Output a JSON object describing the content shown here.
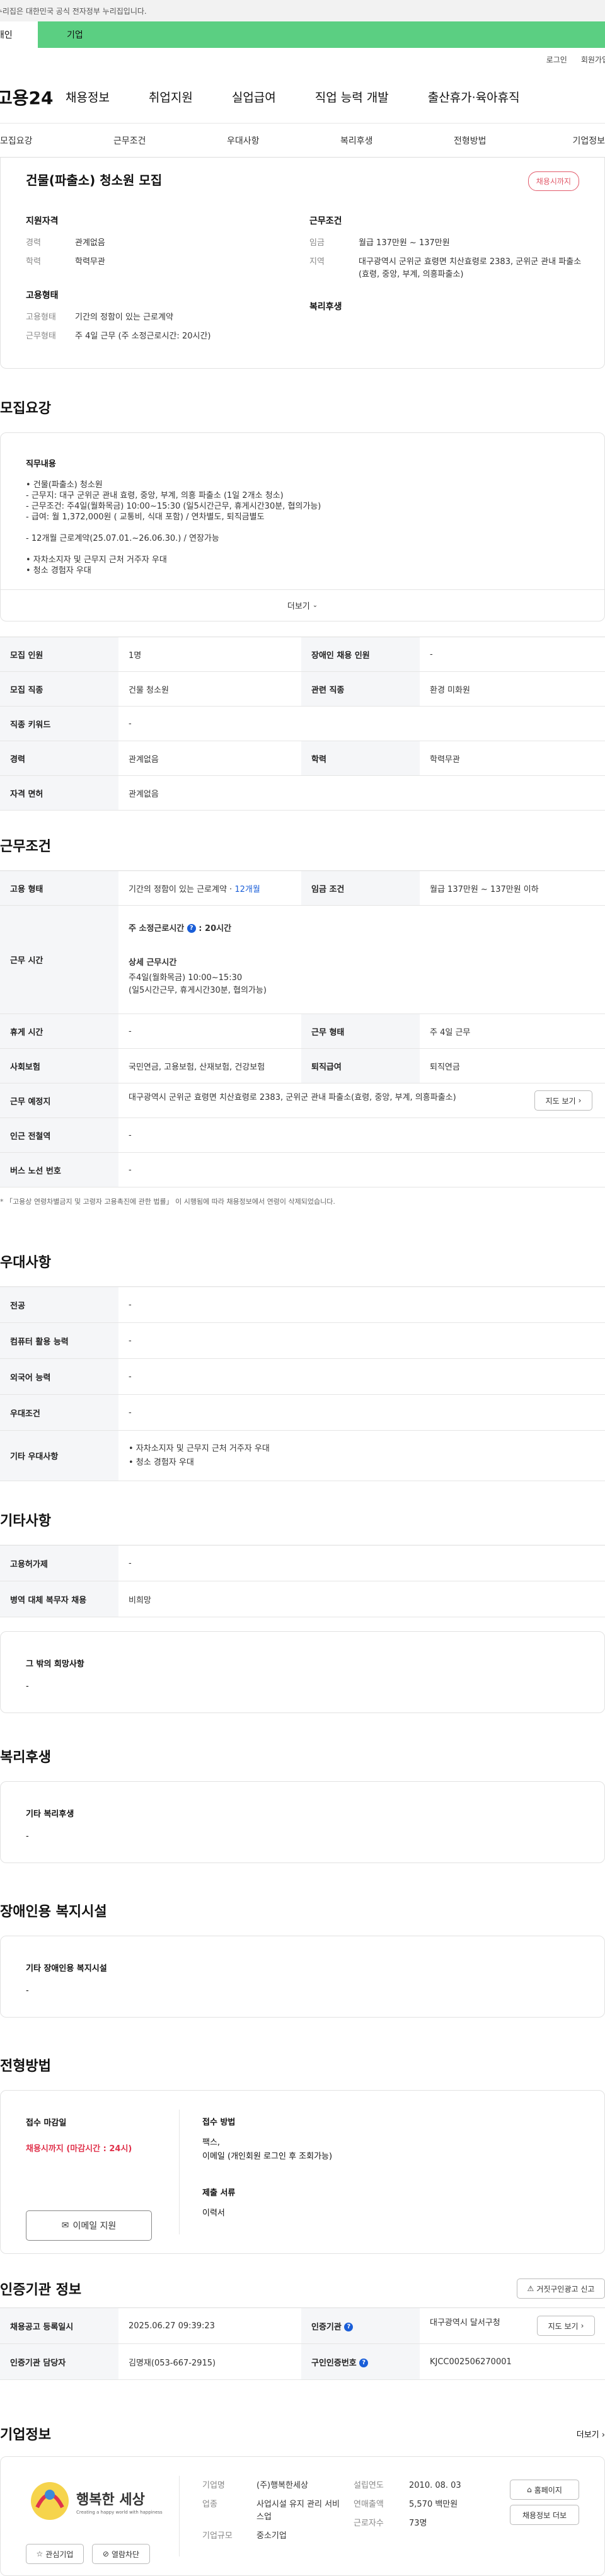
{
  "notice": "이 누리집은 대한민국 공식 전자정부 누리집입니다.",
  "site_tabs": [
    "개인",
    "기업"
  ],
  "util": [
    "로그인",
    "회원가입"
  ],
  "logo": "고용24",
  "gnb": [
    "채용정보",
    "취업지원",
    "실업급여",
    "직업 능력 개발",
    "출산휴가·육아휴직"
  ],
  "anchors": [
    "모집요강",
    "근무조건",
    "우대사항",
    "복리후생",
    "전형방법",
    "기업정보"
  ],
  "header": {
    "title": "건물(파출소) 청소원 모집",
    "badge": "채용시까지"
  },
  "summary": {
    "qual_title": "지원자격",
    "qual": [
      {
        "k": "경력",
        "v": "관계없음"
      },
      {
        "k": "학력",
        "v": "학력무관"
      }
    ],
    "cond_title": "근무조건",
    "cond": [
      {
        "k": "임금",
        "v": "월급 137만원 ~ 137만원"
      },
      {
        "k": "지역",
        "v": "대구광역시 군위군 효령면 치산효령로 2383, 군위군 관내 파출소(효령, 중앙, 부계, 의흥파출소)"
      }
    ],
    "emp_title": "고용형태",
    "emp": [
      {
        "k": "고용형태",
        "v": "기간의 정함이 있는 근로계약"
      },
      {
        "k": "근무형태",
        "v": "주 4일 근무 (주 소정근로시간: 20시간)"
      }
    ],
    "welfare_title": "복리후생"
  },
  "recruit": {
    "title": "모집요강",
    "duty_title": "직무내용",
    "duty_lines": [
      "• 건물(파출소) 청소원",
      "- 근무지: 대구 군위군 관내 효령, 중앙, 부계, 의흥 파출소 (1일 2개소 청소)",
      "- 근무조건: 주4일(월화목금) 10:00~15:30 (일5시간근무, 휴게시간30분, 협의가능)",
      "- 급여: 월 1,372,000원 ( 교통비, 식대 포함) / 연차별도, 퇴직금별도",
      "",
      "- 12개월 근로계약(25.07.01.~26.06.30.) / 연장가능",
      "",
      "• 자차소지자 및 근무지 근처 거주자 우대",
      "• 청소 경험자 우대"
    ],
    "more": "더보기",
    "rows": [
      {
        "h1": "모집 인원",
        "v1": "1명",
        "h2": "장애인 채용 인원",
        "v2": "-"
      },
      {
        "h1": "모집 직종",
        "v1": "건물 청소원",
        "h2": "관련 직종",
        "v2": "환경 미화원"
      },
      {
        "h1": "직종 키워드",
        "v1": "-"
      },
      {
        "h1": "경력",
        "v1": "관계없음",
        "h2": "학력",
        "v2": "학력무관"
      },
      {
        "h1": "자격 면허",
        "v1": "관계없음"
      }
    ]
  },
  "workcond": {
    "title": "근무조건",
    "emp_h": "고용 형태",
    "emp_v": "기간의 정함이 있는 근로계약 · ",
    "emp_months": "12개월",
    "wage_h": "임금 조건",
    "wage_v": "월급 137만원 ~ 137만원 이하",
    "time_h": "근무 시간",
    "time_week": "주 소정근로시간",
    "time_hours": "20시간",
    "time_detail_title": "상세 근무시간",
    "time_detail_1": "주4일(월화목금) 10:00~15:30",
    "time_detail_2": "(일5시간근무, 휴게시간30분, 협의가능)",
    "rest_h": "휴게 시간",
    "rest_v": "-",
    "type_h": "근무 형태",
    "type_v": "주 4일 근무",
    "ins_h": "사회보험",
    "ins_v": "국민연금, 고용보험, 산재보험, 건강보험",
    "ret_h": "퇴직급여",
    "ret_v": "퇴직연금",
    "loc_h": "근무 예정지",
    "loc_v": "대구광역시 군위군 효령면 치산효령로 2383, 군위군 관내 파출소(효령, 중앙, 부계, 의흥파출소)",
    "map_btn": "지도 보기",
    "sub_h": "인근 전철역",
    "sub_v": "-",
    "bus_h": "버스 노선 번호",
    "bus_v": "-",
    "note": "* 「고용상 연령차별금지 및 고령자 고용촉진에 관한 법률」 이 시행됨에 따라 채용정보에서 연령이 삭제되었습니다."
  },
  "pref": {
    "title": "우대사항",
    "rows": [
      {
        "h": "전공",
        "v": "-"
      },
      {
        "h": "컴퓨터 활용 능력",
        "v": "-"
      },
      {
        "h": "외국어 능력",
        "v": "-"
      },
      {
        "h": "우대조건",
        "v": "-"
      }
    ],
    "etc_h": "기타 우대사항",
    "etc_lines": [
      "• 자차소지자 및 근무지 근처 거주자 우대",
      "• 청소 경험자 우대"
    ]
  },
  "other": {
    "title": "기타사항",
    "rows": [
      {
        "h": "고용허가제",
        "v": "-"
      },
      {
        "h": "병역 대체 복무자 채용",
        "v": "비희망"
      }
    ],
    "box_title": "그 밖의 희망사항",
    "box_v": "-"
  },
  "welfare": {
    "title": "복리후생",
    "box_title": "기타 복리후생",
    "box_v": "-"
  },
  "disabled": {
    "title": "장애인용 복지시설",
    "box_title": "기타 장애인용 복지시설",
    "box_v": "-"
  },
  "screening": {
    "title": "전형방법",
    "deadline_title": "접수 마감일",
    "deadline_v": "채용시까지 (마감시간 : 24시)",
    "apply_btn": "이메일 지원",
    "method_title": "접수 방법",
    "method_lines": [
      "팩스,",
      "이메일 (개인회원 로그인 후 조회가능)"
    ],
    "docs_title": "제출 서류",
    "docs_v": "이력서"
  },
  "cert": {
    "title": "인증기관 정보",
    "report_btn": "거짓구인광고 신고",
    "rows": [
      {
        "h1": "채용공고 등록일시",
        "v1": "2025.06.27 09:39:23",
        "h2": "인증기관",
        "v2": "대구광역시 달서구청"
      },
      {
        "h1": "인증기관 담당자",
        "v1": "김명재(053-667-2915)",
        "h2": "구인인증번호",
        "v2": "KJCC002506270001"
      }
    ],
    "map_btn": "지도 보기"
  },
  "company": {
    "title": "기업정보",
    "more": "더보기",
    "logo_text": "행복한 세상",
    "logo_sub": "Creating a happy world with happiness",
    "fields": [
      {
        "k": "기업명",
        "v": "(주)행복한세상"
      },
      {
        "k": "업종",
        "v": "사업시설 유지 관리 서비스업"
      },
      {
        "k": "기업규모",
        "v": "중소기업"
      }
    ],
    "fields2": [
      {
        "k": "설립연도",
        "v": "2010. 08. 03"
      },
      {
        "k": "연매출액",
        "v": "5,570 백만원"
      },
      {
        "k": "근로자수",
        "v": "73명"
      }
    ],
    "btn_home": "홈페이지",
    "btn_other": "채용정보 더보",
    "btn_fav": "관심기업",
    "btn_block": "열람차단"
  },
  "colors": {
    "green": "#5bcf82",
    "red": "#e0334c",
    "blue": "#1a5ed8"
  }
}
